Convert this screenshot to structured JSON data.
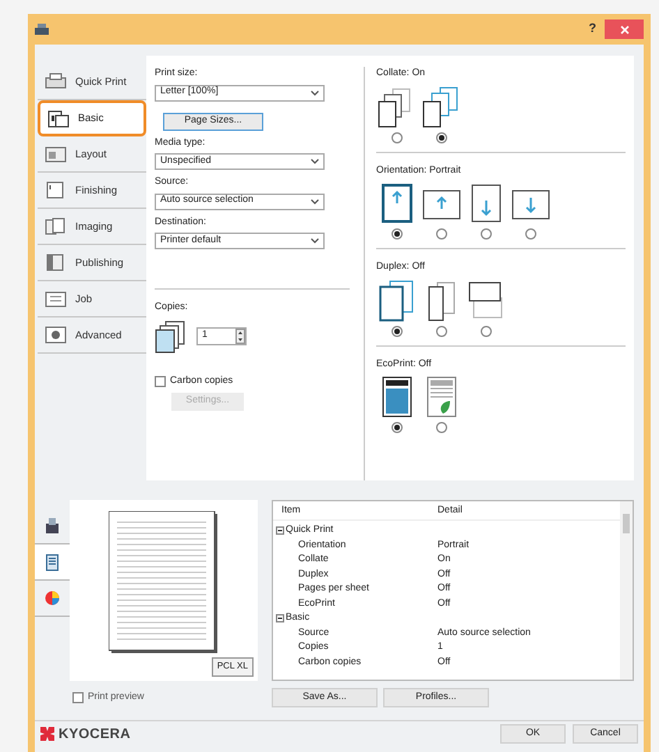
{
  "window": {
    "help": "?"
  },
  "tabs": [
    {
      "label": "Quick Print",
      "kind": "quick",
      "selected": false
    },
    {
      "label": "Basic",
      "kind": "basic",
      "selected": true
    },
    {
      "label": "Layout",
      "kind": "layout",
      "selected": false
    },
    {
      "label": "Finishing",
      "kind": "finishing",
      "selected": false
    },
    {
      "label": "Imaging",
      "kind": "imaging",
      "selected": false
    },
    {
      "label": "Publishing",
      "kind": "publishing",
      "selected": false
    },
    {
      "label": "Job",
      "kind": "job",
      "selected": false
    },
    {
      "label": "Advanced",
      "kind": "advanced",
      "selected": false
    }
  ],
  "basic": {
    "fields": [
      {
        "label": "Print size:",
        "value": "Letter [100%]",
        "button": "Page Sizes..."
      },
      {
        "label": "Media type:",
        "value": "Unspecified"
      },
      {
        "label": "Source:",
        "value": "Auto source selection"
      },
      {
        "label": "Destination:",
        "value": "Printer default"
      }
    ],
    "copies": {
      "label": "Copies:",
      "value": "1"
    },
    "carbon_copies": {
      "label": "Carbon copies",
      "checked": false
    },
    "settings_button": {
      "label": "Settings...",
      "disabled": true
    }
  },
  "groups": [
    {
      "title": "Collate:",
      "value": "On",
      "options": [
        {
          "kind": "uncollated",
          "selected": false
        },
        {
          "kind": "collated",
          "selected": true
        }
      ]
    },
    {
      "title": "Orientation:",
      "value": "Portrait",
      "options": [
        {
          "kind": "portrait",
          "selected": true
        },
        {
          "kind": "landscape",
          "selected": false
        },
        {
          "kind": "portrait-rotated",
          "selected": false
        },
        {
          "kind": "landscape-rotated",
          "selected": false
        }
      ]
    },
    {
      "title": "Duplex:",
      "value": "Off",
      "options": [
        {
          "kind": "duplex-off",
          "selected": true
        },
        {
          "kind": "long-edge",
          "selected": false
        },
        {
          "kind": "short-edge",
          "selected": false
        }
      ]
    },
    {
      "title": "EcoPrint:",
      "value": "Off",
      "options": [
        {
          "kind": "eco-off",
          "selected": true
        },
        {
          "kind": "eco-on",
          "selected": false
        }
      ]
    }
  ],
  "view_tabs": [
    {
      "kind": "printer",
      "selected": false
    },
    {
      "kind": "page",
      "selected": true
    },
    {
      "kind": "color",
      "selected": false
    }
  ],
  "preview": {
    "badge": "PCL XL"
  },
  "summary": {
    "columns": [
      "Item",
      "Detail"
    ],
    "rows": [
      {
        "item": "Quick Print",
        "expanded": true,
        "children": [
          {
            "item": "Orientation",
            "detail": "Portrait"
          },
          {
            "item": "Collate",
            "detail": "On"
          },
          {
            "item": "Duplex",
            "detail": "Off"
          },
          {
            "item": "Pages per sheet",
            "detail": "Off"
          },
          {
            "item": "EcoPrint",
            "detail": "Off"
          }
        ]
      },
      {
        "item": "Basic",
        "expanded": true,
        "children": [
          {
            "item": "Source",
            "detail": "Auto source selection"
          },
          {
            "item": "Copies",
            "detail": "1"
          },
          {
            "item": "Carbon copies",
            "detail": "Off"
          }
        ]
      }
    ]
  },
  "print_preview": {
    "label": "Print preview",
    "checked": false
  },
  "buttons": [
    "Save As...",
    "Profiles..."
  ],
  "logo": "KYOCERA",
  "dialog_buttons": [
    "OK",
    "Cancel"
  ]
}
